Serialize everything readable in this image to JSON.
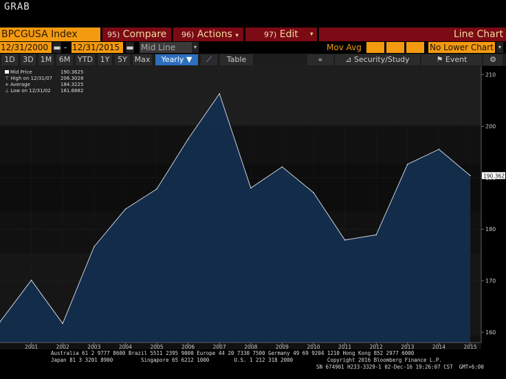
{
  "app": {
    "title": "GRAB"
  },
  "toolbar": {
    "ticker": "BPCGUSA Index",
    "compare_num": "95)",
    "compare_label": "Compare",
    "actions_num": "96)",
    "actions_label": "Actions",
    "edit_num": "97)",
    "edit_label": "Edit",
    "chart_type": "Line Chart"
  },
  "controls": {
    "start_date": "12/31/2000",
    "end_date": "12/31/2015",
    "price_field": "Mid Line",
    "mov_avg_label": "Mov Avg",
    "lower_chart": "No Lower Chart",
    "periods": [
      "1D",
      "3D",
      "1M",
      "6M",
      "YTD",
      "1Y",
      "5Y",
      "Max"
    ],
    "frequency": "Yearly",
    "table_label": "Table",
    "security_study_label": "Security/Study",
    "event_label": "Event"
  },
  "legend": {
    "mid_price_label": "Mid Price",
    "mid_price_value": "190.3625",
    "high_label": "High on 12/31/07",
    "high_value": "206.3028",
    "average_label": "Average",
    "average_value": "184.3225",
    "low_label": "Low on 12/31/02",
    "low_value": "161.6882"
  },
  "colors": {
    "accent": "#f39a10",
    "brand_red": "#7b0a14",
    "area_fill": "#132f4e",
    "line": "#c9d3df"
  },
  "chart_data": {
    "type": "area",
    "x": [
      "2000",
      "2001",
      "2002",
      "2003",
      "2004",
      "2005",
      "2006",
      "2007",
      "2008",
      "2009",
      "2010",
      "2011",
      "2012",
      "2013",
      "2014",
      "2015"
    ],
    "x_tick_labels": [
      "2001",
      "2002",
      "2003",
      "2004",
      "2005",
      "2006",
      "2007",
      "2008",
      "2009",
      "2010",
      "2011",
      "2012",
      "2013",
      "2014",
      "2015"
    ],
    "series": [
      {
        "name": "Mid Price",
        "values": [
          162.0,
          170.1,
          161.7,
          176.6,
          183.9,
          187.8,
          197.5,
          206.3,
          188.0,
          192.1,
          187.1,
          177.9,
          178.9,
          192.6,
          195.5,
          190.4
        ]
      }
    ],
    "ylim": [
      158,
      211
    ],
    "y_ticks": [
      160,
      170,
      180,
      190,
      200,
      210
    ],
    "last_value_label": "190.3625",
    "grid": true
  },
  "footer": {
    "line1": "Australia 61 2 9777 8600 Brazil 5511 2395 9000 Europe 44 20 7330 7500 Germany 49 69 9204 1210 Hong Kong 852 2977 6000",
    "line2": "Japan 81 3 3201 8900         Singapore 65 6212 1000        U.S. 1 212 318 2000           Copyright 2016 Bloomberg Finance L.P.",
    "line3": "SN 674901 H233-3329-1 02-Dec-16 19:26:07 CST  GMT+6:00"
  }
}
